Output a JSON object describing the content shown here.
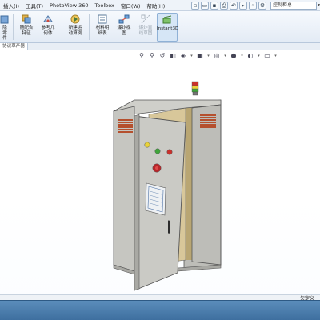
{
  "menubar": {
    "items": [
      "插入(I)",
      "工具(T)",
      "PhotoView 360",
      "Toolbox",
      "窗口(W)",
      "帮助(H)"
    ],
    "search_text": "控制柜总..."
  },
  "ribbon": {
    "buttons": [
      {
        "label": "隐\n零\n件",
        "icon": "hide-part-icon"
      },
      {
        "label": "随配合\n特征",
        "icon": "mate-feature-icon"
      },
      {
        "label": "参考几\n何体",
        "icon": "reference-geometry-icon"
      },
      {
        "label": "新建运\n动算例",
        "icon": "new-motion-study-icon"
      },
      {
        "label": "材料明\n细表",
        "icon": "bill-of-materials-icon"
      },
      {
        "label": "爆炸视\n图",
        "icon": "exploded-view-icon"
      },
      {
        "label": "爆炸直\n线草图",
        "icon": "explode-line-sketch-icon"
      },
      {
        "label": "Instant3D",
        "icon": "instant3d-icon"
      }
    ]
  },
  "tabstrip": {
    "feature_tab": "协议草产器"
  },
  "status": {
    "right_text": "欠定义"
  },
  "colors": {
    "cabinet": "#c9c9c4",
    "cabinet_dark": "#9e9e99",
    "interior": "#d8c79a",
    "vents": "#b5502e",
    "taskbar": "#4a7cab"
  }
}
